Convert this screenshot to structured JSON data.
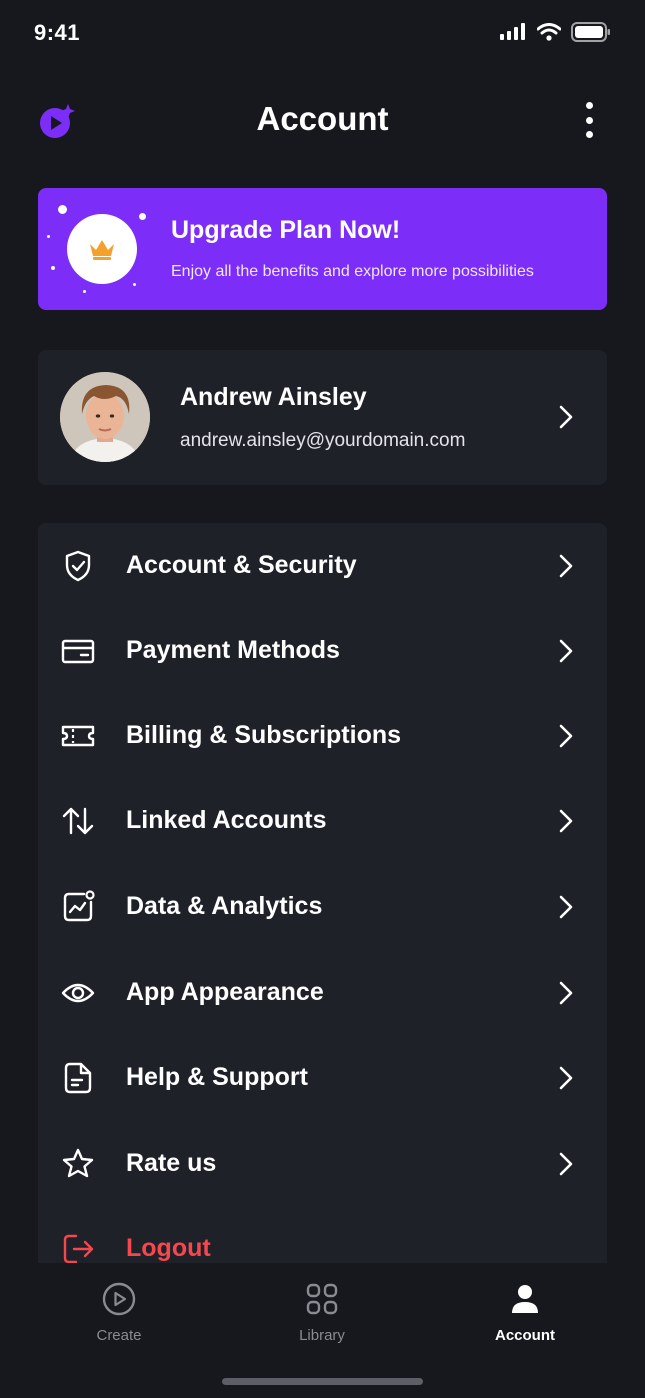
{
  "status_bar": {
    "time": "9:41",
    "icons": [
      "cellular-signal-icon",
      "wifi-icon",
      "battery-icon"
    ]
  },
  "header": {
    "title": "Account",
    "logo_icon": "app-logo-icon",
    "more_icon": "more-vertical-icon"
  },
  "upgrade_banner": {
    "title": "Upgrade Plan Now!",
    "subtitle": "Enjoy all the benefits and explore more possibilities",
    "icon": "crown-icon"
  },
  "profile": {
    "name": "Andrew Ainsley",
    "email": "andrew.ainsley@yourdomain.com"
  },
  "menu": {
    "items": [
      {
        "label": "Account & Security",
        "icon": "shield-icon"
      },
      {
        "label": "Payment Methods",
        "icon": "credit-card-icon"
      },
      {
        "label": "Billing & Subscriptions",
        "icon": "ticket-icon"
      },
      {
        "label": "Linked Accounts",
        "icon": "arrows-up-down-icon"
      },
      {
        "label": "Data & Analytics",
        "icon": "chart-icon"
      },
      {
        "label": "App Appearance",
        "icon": "eye-icon"
      },
      {
        "label": "Help & Support",
        "icon": "document-icon"
      },
      {
        "label": "Rate us",
        "icon": "star-icon"
      }
    ],
    "logout": {
      "label": "Logout",
      "icon": "logout-icon"
    }
  },
  "tab_bar": {
    "tabs": [
      {
        "label": "Create",
        "icon": "play-circle-icon",
        "active": false
      },
      {
        "label": "Library",
        "icon": "grid-icon",
        "active": false
      },
      {
        "label": "Account",
        "icon": "user-icon",
        "active": true
      }
    ]
  },
  "colors": {
    "background": "#17181d",
    "card": "#1f2129",
    "accent": "#7c2ef8",
    "danger": "#f6474e",
    "crown": "#f4a12b"
  }
}
